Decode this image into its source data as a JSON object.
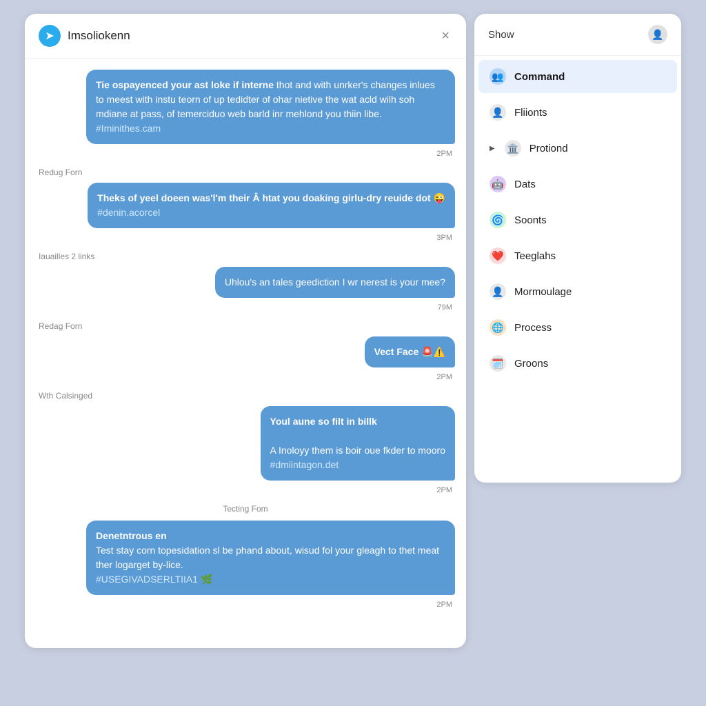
{
  "chat": {
    "title": "Imsoliokenn",
    "close_label": "×",
    "messages": [
      {
        "id": "msg1",
        "text": "Tie ospayenced your ast loke if interne thot and with unrker's changes inlues to meest with instu teorn of up tedidter of ohar nietive the wat acld wilh soh mdiane at pass, of temerciduo web barld inr mehlond you thiin libe.",
        "hashtag": "#Iminithes.cam",
        "time": "2PM",
        "sender": null
      },
      {
        "id": "msg2",
        "sender_label": "Redug Forn",
        "text": "Theks of yeel doeen was'l'm their Â htat you doaking girlu-dry reuide dot 😜",
        "hashtag": "#denin.acorcel",
        "time": "3PM",
        "sender": null
      },
      {
        "id": "msg3",
        "links_label": "Iauailles 2 links",
        "text": "Uhlou's an tales geediction I wr nerest is your mee?",
        "hashtag": null,
        "time": "79M",
        "sender": null
      },
      {
        "id": "msg4",
        "sender_label": "Redag Forn",
        "text": "Vect Face 🚨⚠️",
        "hashtag": null,
        "time": "2PM",
        "sender": null
      },
      {
        "id": "msg5",
        "sender_label": "Wth Calsinged",
        "text_bold": "Youl aune so filt in billk",
        "text_body": "A Inoloyy them is boir oue fkder to mooro",
        "hashtag": "#dmiintagon.det",
        "time": "2PM",
        "sender": null
      },
      {
        "id": "msg6",
        "section_label": "Tecting Fom",
        "text_bold": "Denetntrous en",
        "text_body": "Test stay corn topesidation sl be phand about, wisud fol your gleagh to thet meat ther logarget by-lice.",
        "hashtag": "#USEGIVADSERLTIIA1 🌿",
        "time": "2PM",
        "sender": null
      }
    ]
  },
  "right_panel": {
    "header_title": "Show",
    "menu_items": [
      {
        "id": "command",
        "label": "Command",
        "icon": "👥",
        "icon_bg": "#b3d4f5",
        "active": true,
        "arrow": false
      },
      {
        "id": "fliionts",
        "label": "Fliionts",
        "icon": "👤",
        "icon_bg": "#e0e0e0",
        "active": false,
        "arrow": false
      },
      {
        "id": "protiond",
        "label": "Protiond",
        "icon": "🏛️",
        "icon_bg": "#e0e0e0",
        "active": false,
        "arrow": true
      },
      {
        "id": "dats",
        "label": "Dats",
        "icon": "🤖",
        "icon_bg": "#e8d4f5",
        "active": false,
        "arrow": false
      },
      {
        "id": "soonts",
        "label": "Soonts",
        "icon": "🌀",
        "icon_bg": "#d4f5e0",
        "active": false,
        "arrow": false
      },
      {
        "id": "teeglahs",
        "label": "Teeglahs",
        "icon": "❤️",
        "icon_bg": "#fde0e0",
        "active": false,
        "arrow": false
      },
      {
        "id": "mormoulage",
        "label": "Mormoulage",
        "icon": "👤",
        "icon_bg": "#e0e0e0",
        "active": false,
        "arrow": false
      },
      {
        "id": "process",
        "label": "Process",
        "icon": "🌐",
        "icon_bg": "#fde0c0",
        "active": false,
        "arrow": false
      },
      {
        "id": "groons",
        "label": "Groons",
        "icon": "🗓️",
        "icon_bg": "#e0e0e0",
        "active": false,
        "arrow": false
      }
    ]
  }
}
